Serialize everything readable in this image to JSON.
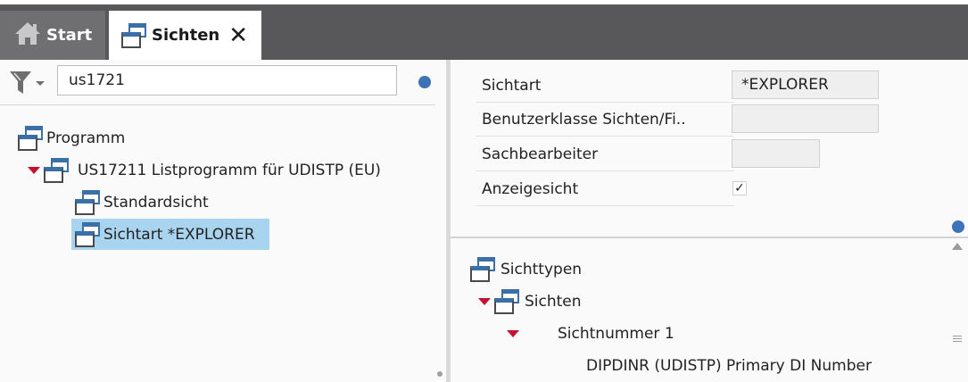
{
  "tabs": {
    "start_label": "Start",
    "sichten_label": "Sichten",
    "close_glyph": "✕"
  },
  "filter": {
    "search_value": "us1721"
  },
  "tree": {
    "root": "Programm",
    "program": "US17211 Listprogramm für UDISTP (EU)",
    "view1": "Standardsicht",
    "view2": "Sichtart *EXPLORER"
  },
  "properties": {
    "rows": [
      {
        "label": "Sichtart",
        "value": "*EXPLORER"
      },
      {
        "label": "Benutzerklasse Sichten/Fi..",
        "value": ""
      },
      {
        "label": "Sachbearbeiter",
        "value": ""
      },
      {
        "label": "Anzeigesicht",
        "checked": true
      }
    ],
    "check_glyph": "✓"
  },
  "lower_tree": {
    "root": "Sichttypen",
    "child": "Sichten",
    "item": "Sichtnummer 1",
    "field": "DIPDINR (UDISTP) Primary DI Number"
  },
  "colors": {
    "tabbar": "#58585a",
    "accent_blue": "#3d73b8",
    "selection": "#a9d4f0",
    "expand_triangle": "#c8102e"
  }
}
